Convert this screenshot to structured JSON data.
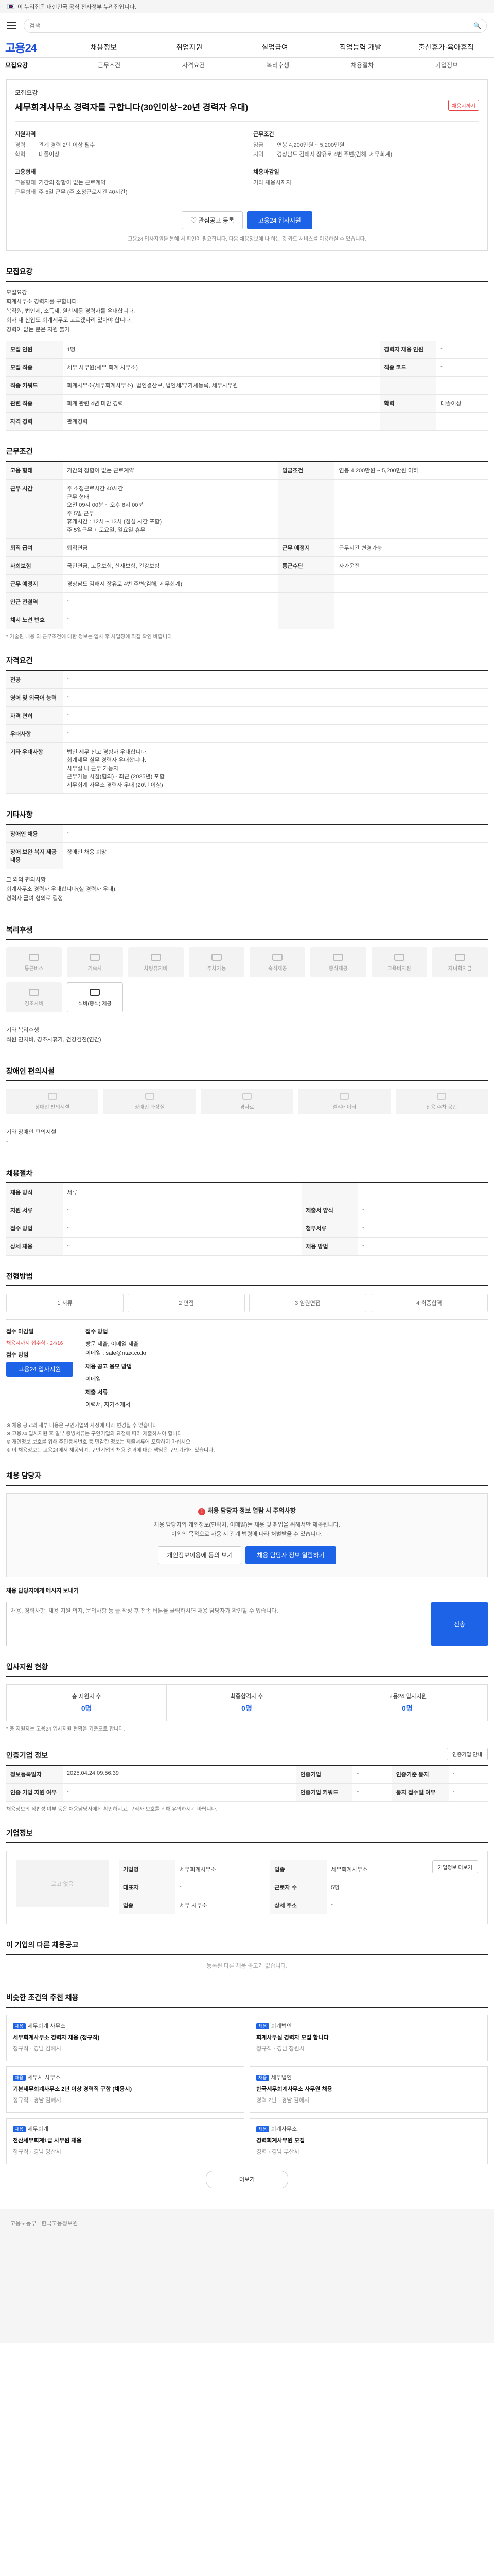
{
  "gov_bar": {
    "text": "이 누리집은 대한민국 공식 전자정부 누리집입니다."
  },
  "header": {
    "search_placeholder": "검색"
  },
  "gnb": {
    "logo": "고용24",
    "items": [
      "채용정보",
      "취업지원",
      "실업급여",
      "직업능력 개발",
      "출산휴가·육아휴직"
    ]
  },
  "subtabs": [
    "모집요강",
    "근무조건",
    "자격요건",
    "복리후생",
    "채용절차",
    "기업정보"
  ],
  "hero": {
    "company": "모집요강",
    "title": "세무회계사무소 경력자를 구합니다(30인이상~20년 경력자 우대)",
    "badge": "채용시까지",
    "recruit_label": "지원자격",
    "recruit": [
      {
        "k": "경력",
        "v": "관계 경력 2년 이상 필수"
      },
      {
        "k": "학력",
        "v": "대졸이상"
      }
    ],
    "condition_label": "근무조건",
    "condition": [
      {
        "k": "임금",
        "v": "연봉 4,200만원 ~ 5,200만원"
      },
      {
        "k": "지역",
        "v": "경상남도 김해시 장유로 4번 주변(김해, 세무회계)"
      }
    ],
    "type_label": "고용형태",
    "type": [
      {
        "k": "고용형태",
        "v": "기간의 정함이 없는 근로계약"
      },
      {
        "k": "근무형태",
        "v": "주 5일 근무 (주 소정근로시간 40시간)"
      }
    ],
    "deadline_label": "채용마감일",
    "deadline": "기타 채용시까지",
    "btn_save": "관심공고 등록",
    "btn_apply": "고용24 입사지원",
    "note": "고용24 입사지원을 통해 서 확인이 필요합니다. 다음 채용정보에 나 하는 것 카드 서비스를 이용하실 수 있습니다."
  },
  "summary": {
    "title": "모집요강",
    "lines": [
      "모집요강",
      "회계사무소 경력자를 구합니다.",
      "복직원, 법인세, 소득세, 원천세등 경력자를 우대합니다.",
      "회사 내 신입도 회계세무도 고르겠자리 있아야 합니다.",
      "경력이 없는 분은 지원 불가."
    ],
    "rows": [
      {
        "h": "모집 인원",
        "v": "1명",
        "h2": "경력자 채용 인원",
        "v2": "-"
      },
      {
        "h": "모집 직종",
        "v": "세무 사무원(세무 회계 사무소)",
        "h2": "직종 코드",
        "v2": "-"
      },
      {
        "h": "직종 키워드",
        "v": "회계사무소(세무회계사무소), 법인결산보, 법인세/부가세등록, 세무사무원",
        "h2": "",
        "v2": ""
      },
      {
        "h": "관련 직종",
        "v": "회계 관련 4년 미만 경력",
        "h2": "학력",
        "v2": "대졸이상"
      },
      {
        "h": "자격 경력",
        "v": "관계경력",
        "h2": "",
        "v2": ""
      }
    ]
  },
  "work": {
    "title": "근무조건",
    "rows": [
      {
        "h": "고용 형태",
        "v": "기간의 정함이 없는 근로계약",
        "h2": "임금조건",
        "v2": "연봉 4,200만원 ~ 5,200만원 이하"
      },
      {
        "h": "근무 시간",
        "v": "주 소정근로시간 40시간\n근무 형태\n오전 09시 00분 ~ 오후 6시 00분\n주 5일 근무\n휴게시간 : 12시 ~ 13시 (점심 시간 포함)\n주 5일근무 + 토요일, 일요일 휴무",
        "h2": "",
        "v2": ""
      },
      {
        "h": "퇴직 급여",
        "v": "퇴직연금",
        "h2": "근무 예정지",
        "v2": "근무시간 변경가능"
      },
      {
        "h": "사회보험",
        "v": "국민연금, 고용보험, 산재보험, 건강보험",
        "h2": "통근수단",
        "v2": "자가운전"
      },
      {
        "h": "근무 예정지",
        "v": "경상남도 김해시 장유로 4번 주변(김해, 세무회계)",
        "h2": "",
        "v2": ""
      },
      {
        "h": "인근 전철역",
        "v": "-",
        "h2": "",
        "v2": ""
      },
      {
        "h": "채시 노선 번호",
        "v": "-",
        "h2": "",
        "v2": ""
      }
    ],
    "note": "* 기술된 내용 외 근무조건에 대한 정보는 입사 후 사업장에 직접 확인 바랍니다."
  },
  "qualify": {
    "title": "자격요건",
    "rows": [
      {
        "h": "전공",
        "v": "-"
      },
      {
        "h": "영어 및 외국어 능력",
        "v": "-"
      },
      {
        "h": "자격 면허",
        "v": "-"
      },
      {
        "h": "우대사항",
        "v": "-"
      },
      {
        "h": "기타 우대사항",
        "v": "법인 세무 신고 경험자 우대합니다.\n회계세무 실무 경력자 우대합니다.\n사무실 내 근무 가능자\n근무가능 시점(협의) - 최근 (2025년) 포함\n세무회계 사무소 경력자 우대 (20년 이상)"
      }
    ]
  },
  "welfare": {
    "title": "기타사항",
    "rows": [
      {
        "h": "장애인 채용",
        "v": "-"
      },
      {
        "h": "장애 보완 복지 제공 내용",
        "v": "장애인 채용 희망"
      }
    ],
    "text": "그 외의 편의사항\n회계사무소 경력자 우대합니다(실 경력자 우대).\n경력자 급여 협의로 결정"
  },
  "benefits": {
    "title": "복리후생",
    "items": [
      "통근버스",
      "기숙사",
      "차량유지비",
      "주차가능",
      "숙식제공",
      "중식제공",
      "교육비지원",
      "자녀학자금",
      "경조사비",
      "식비(중식) 제공"
    ],
    "active_index": 9,
    "text": "기타 복리후생\n직원 연차비, 경조사휴가, 건강검진(연간)"
  },
  "disability": {
    "title": "장애인 편의시설",
    "items": [
      "장애인 편의시설",
      "장애인 화장실",
      "경사로",
      "엘리베이터",
      "전용 주차 공간"
    ],
    "text": "기타 장애인 편의시설\n-"
  },
  "process": {
    "title": "채용절차",
    "rows": [
      {
        "h": "채용 방식",
        "v": "서류",
        "h2": "",
        "v2": ""
      },
      {
        "h": "지원 서류",
        "v": "-",
        "h2": "제출서 양식",
        "v2": "-"
      },
      {
        "h": "접수 방법",
        "v": "-",
        "h2": "첨부서류",
        "v2": "-"
      },
      {
        "h": "상세 채용",
        "v": "-",
        "h2": "채용 방법",
        "v2": "-"
      }
    ]
  },
  "apply_status": {
    "title": "전형방법",
    "tabs": [
      "1 서류",
      "2 면접",
      "3 임원면접",
      "4 최종합격"
    ],
    "deadline_label": "접수 마감일",
    "deadline": "채용시까지 접수함 - 24/16",
    "apply_label": "접수 방법",
    "apply_value": "고용24 입사지원",
    "contact_label": "접수 방법",
    "contact_value": "방문 제출, 이메일 제출\n이메일 : sale@ntax.co.kr",
    "method_label": "채용 공고 응모 방법",
    "method": "이메일",
    "docs_label": "제출 서류",
    "docs": "이력서, 자기소개서",
    "notes": [
      "※ 채용 공고의 세부 내용은 구인기업의 사정에 따라 변경될 수 있습니다.",
      "※ 고용24 입사지원 후 일부 증빙서류는 구인기업의 요청에 따라 제출하셔야 합니다.",
      "※ 개인정보 보호를 위해 주민등록번호 등 민감한 정보는 제출서류에 포함하지 마십시오.",
      "※ 이 채용정보는 고용24에서 제공되며, 구인기업의 채용 결과에 대한 책임은 구인기업에 있습니다."
    ]
  },
  "contact": {
    "title": "채용 담당자",
    "alert": "채용 담당자 정보 열람 시 주의사항",
    "body1": "채용 담당자의 개인정보(연락처, 이메일)는 채용 및 취업을 위해서만 제공됩니다.",
    "body2": "이외의 목적으로 사용 시 관계 법령에 따라 처벌받을 수 있습니다.",
    "btn_agree": "개인정보이용에 동의 보기",
    "btn_view": "채용 담당자 정보 열람하기",
    "msg_label": "채용 담당자에게 메시지 보내기",
    "msg_placeholder": "채용, 경력사항, 채용 지원 의지, 문의사항 등 글 작성 후 전송 버튼을 클릭하시면 채용 담당자가 확인할 수 있습니다.",
    "btn_send": "전송"
  },
  "stats": {
    "title": "입사지원 현황",
    "items": [
      {
        "label": "총 지원자 수",
        "value": "0명"
      },
      {
        "label": "최종합격자 수",
        "value": "0명"
      },
      {
        "label": "고용24 입사지원",
        "value": "0명"
      }
    ],
    "note": "* 총 지원자는 고용24 입사지원 현황을 기준으로 합니다."
  },
  "info": {
    "title": "인증기업 정보",
    "btn": "인증기업 안내",
    "rows": [
      {
        "h": "정보등록일자",
        "v": "2025.04.24 09:56:39",
        "h2": "인증기업",
        "v2": "-",
        "h3": "인증기준 통지",
        "v3": "-"
      },
      {
        "h": "인증 기업 지원 여부",
        "v": "-",
        "h2": "인증기업 키워드",
        "v2": "-",
        "h3": "통지 접수일 여부",
        "v3": "-"
      }
    ],
    "note": "채용정보의 적법성 여부 등은 채용담당자에게 확인하시고, 구직자 보호를 위해 유의하시기 바랍니다."
  },
  "company": {
    "title": "기업정보",
    "logo": "로고 없음",
    "rows": [
      {
        "h": "기업명",
        "v": "세무회계사무소",
        "h2": "업종",
        "v2": "세무회계사무소"
      },
      {
        "h": "대표자",
        "v": "-",
        "h2": "근로자 수",
        "v2": "5명"
      },
      {
        "h": "업종",
        "v": "세무 사무소",
        "h2": "상세 주소",
        "v2": "-"
      }
    ],
    "btn_more": "기업정보 더보기"
  },
  "related": {
    "title": "이 기업의 다른 채용공고",
    "empty": "등록된 다른 채용 공고가 없습니다.",
    "title2": "비슷한 조건의 추천 채용",
    "cards": [
      {
        "tag": "채용",
        "company": "세무회계 사무소",
        "title": "세무회계사무소 경력자 채용 (정규직)",
        "meta": "정규직 · 경남 김해시"
      },
      {
        "tag": "채용",
        "company": "회계법인",
        "title": "회계사무실 경력자 모집 합니다",
        "meta": "정규직 · 경남 창원시"
      },
      {
        "tag": "채용",
        "company": "세무사 사무소",
        "title": "기본세무회계사무소 2년 이상 경력직 구함 (채용시)",
        "meta": "정규직 · 경남 김해시"
      },
      {
        "tag": "채용",
        "company": "세무법인",
        "title": "한국세무회계사무소 사무원 채용",
        "meta": "경력 2년 · 경남 김해시"
      },
      {
        "tag": "채용",
        "company": "세무회계",
        "title": "전산세무회계1급 사무원 채용",
        "meta": "정규직 · 경남 양산시"
      },
      {
        "tag": "채용",
        "company": "회계사무소",
        "title": "경력회계사무원 모집",
        "meta": "경력 · 경남 부산시"
      }
    ],
    "btn_more": "더보기"
  },
  "footer": {
    "text": "고용노동부 · 한국고용정보원"
  }
}
